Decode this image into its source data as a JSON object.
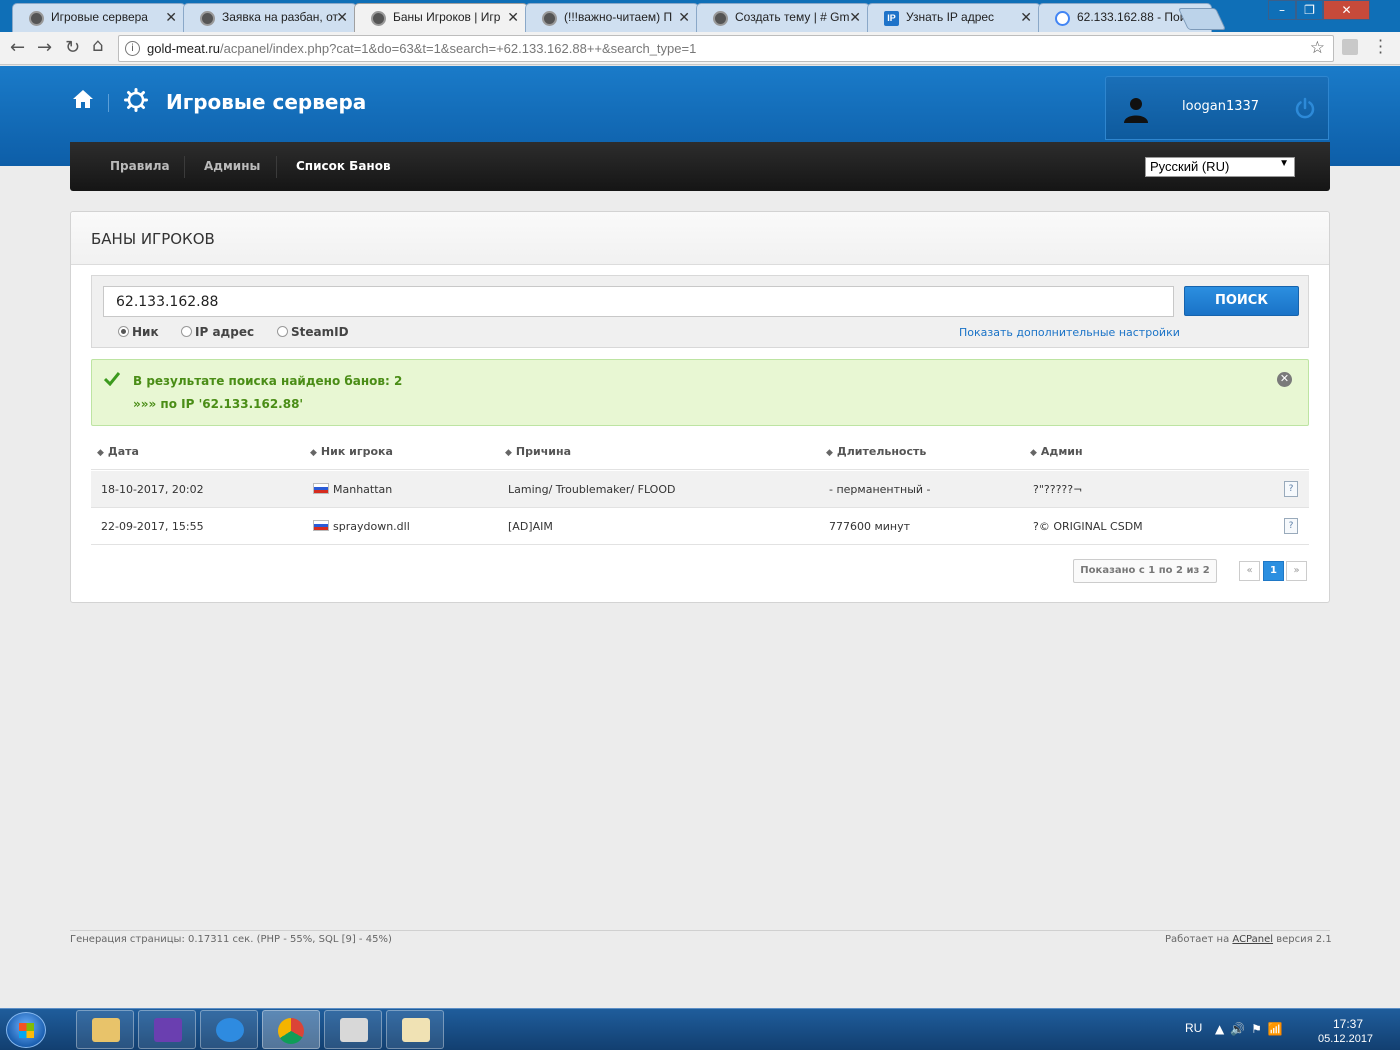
{
  "browser": {
    "tabs": [
      {
        "title": "Игровые сервера",
        "icon": "globe-icon"
      },
      {
        "title": "Заявка на разбан, от",
        "icon": "globe-icon"
      },
      {
        "title": "Баны Игроков | Игр",
        "icon": "globe-icon",
        "active": true
      },
      {
        "title": "(!!!важно-читаем) П",
        "icon": "globe-icon"
      },
      {
        "title": "Создать тему | # Gm",
        "icon": "globe-icon"
      },
      {
        "title": "Узнать IP адрес",
        "icon": "ip-icon"
      },
      {
        "title": "62.133.162.88 - Пои",
        "icon": "google-icon"
      }
    ],
    "url_host": "gold-meat.ru",
    "url_path": "/acpanel/index.php?cat=1&do=63&t=1&search=+62.133.162.88++&search_type=1"
  },
  "site": {
    "title": "Игровые сервера",
    "username": "loogan1337"
  },
  "nav": {
    "items": [
      "Правила",
      "Админы",
      "Список Банов"
    ],
    "active": "Список Банов",
    "language": "Русский (RU)"
  },
  "panel": {
    "title": "БАНЫ ИГРОКОВ"
  },
  "search": {
    "value": "62.133.162.88",
    "button": "ПОИСК",
    "options": [
      "Ник",
      "IP адрес",
      "SteamID"
    ],
    "selected": "Ник",
    "advanced_link": "Показать дополнительные настройки"
  },
  "alert": {
    "line1": "В результате поиска найдено банов: 2",
    "line2": "»»» по IP '62.133.162.88'"
  },
  "table": {
    "columns": [
      "Дата",
      "Ник игрока",
      "Причина",
      "Длительность",
      "Админ"
    ],
    "rows": [
      {
        "date": "18-10-2017, 20:02",
        "nick": "Manhattan",
        "reason": "Laming/ Troublemaker/ FLOOD",
        "duration": "- перманентный -",
        "admin": "?\"?????¬"
      },
      {
        "date": "22-09-2017, 15:55",
        "nick": "spraydown.dll",
        "reason": "[AD]AIM",
        "duration": "777600 минут",
        "admin": "?© ORIGINAL CSDM"
      }
    ]
  },
  "pagination": {
    "info": "Показано с 1 по 2 из 2",
    "prev": "«",
    "current": "1",
    "next": "»"
  },
  "footer": {
    "left": "Генерация страницы: 0.17311 сек. (PHP - 55%, SQL [9] - 45%)",
    "right_prefix": "Работает на ",
    "right_link": "ACPanel",
    "right_suffix": " версия 2.1"
  },
  "taskbar": {
    "lang": "RU",
    "time": "17:37",
    "date": "05.12.2017"
  }
}
